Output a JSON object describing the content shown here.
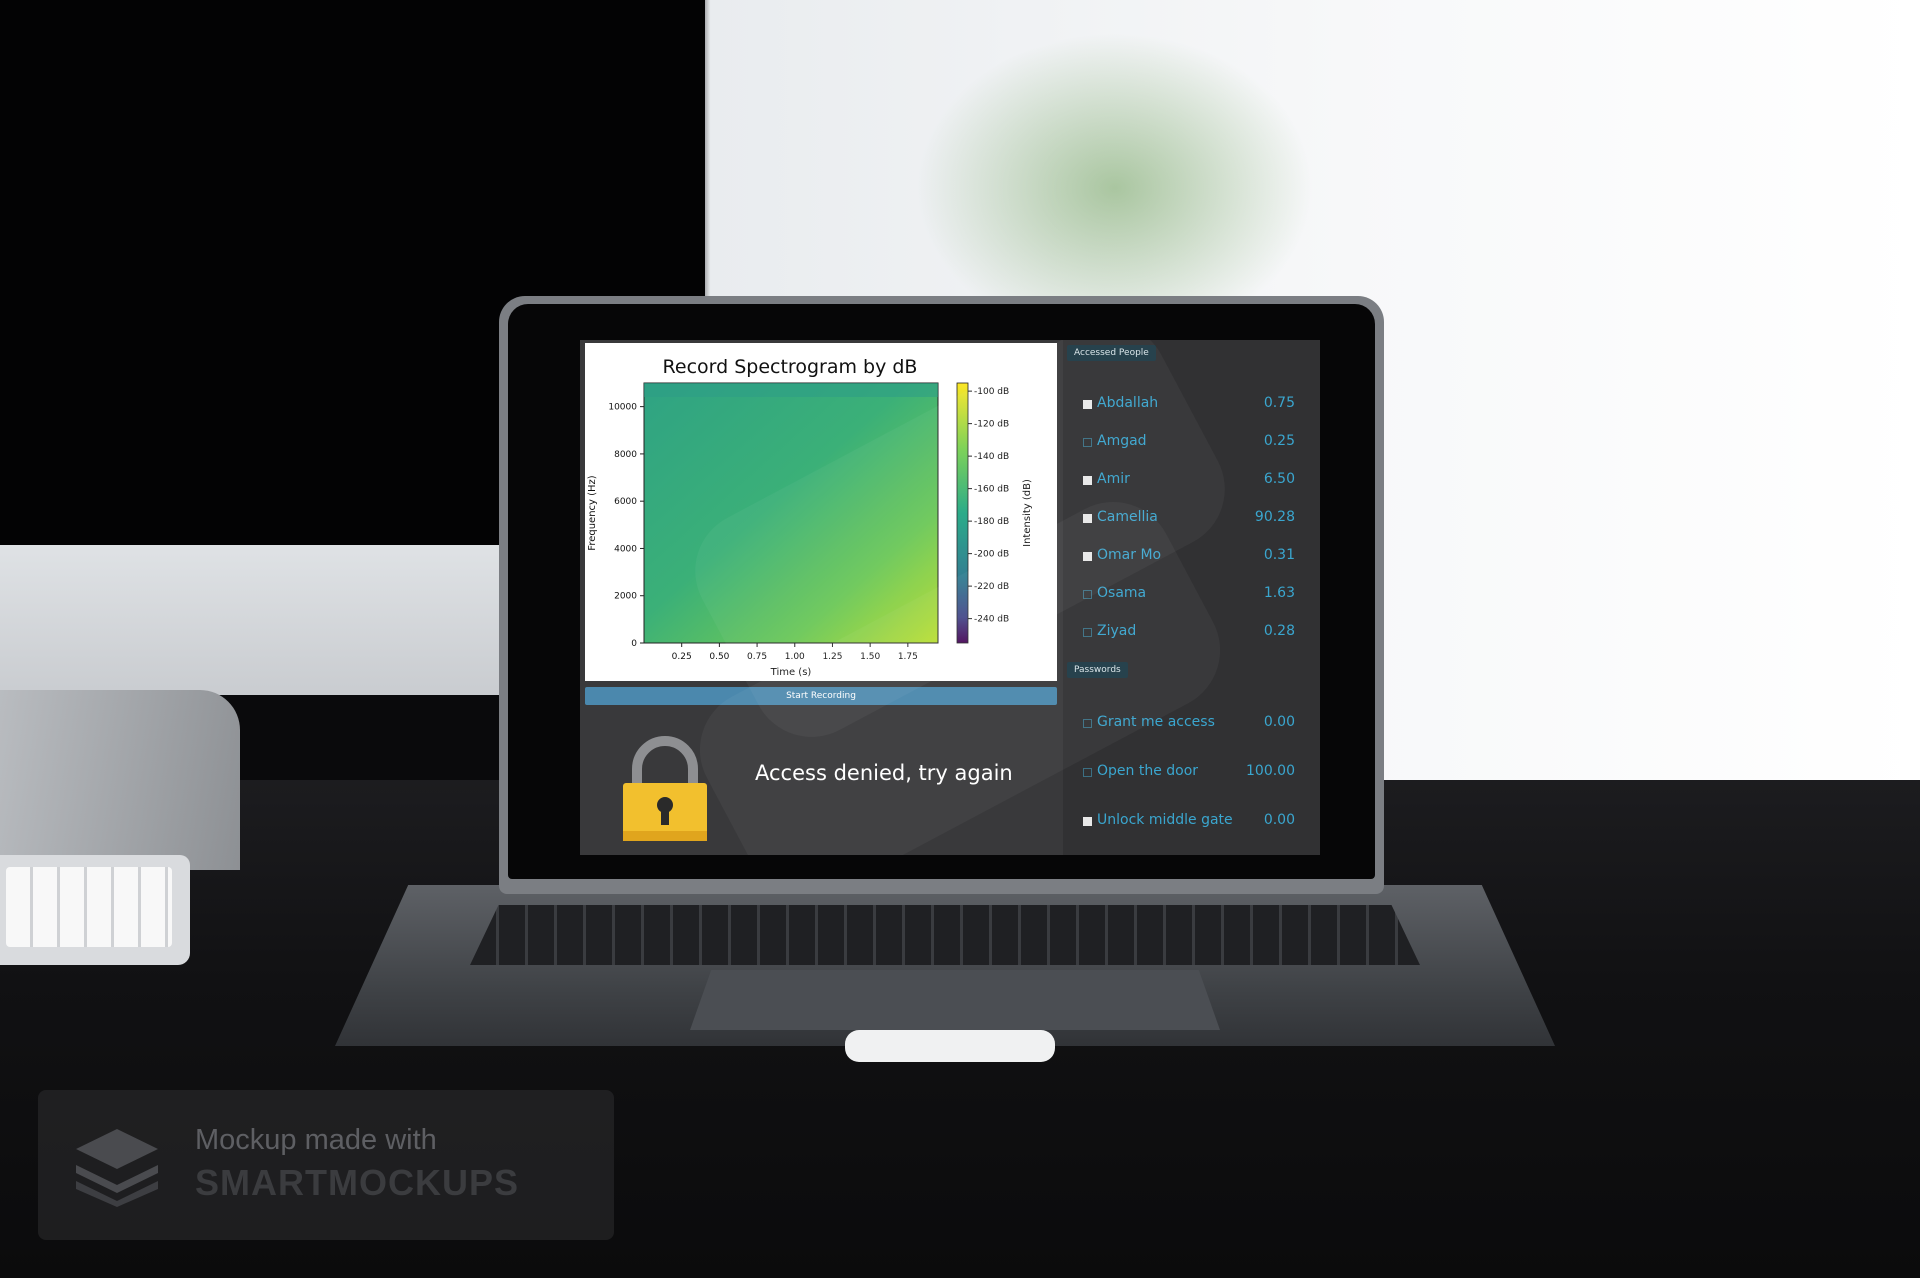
{
  "chart": {
    "title": "Record Spectrogram by dB",
    "xlabel": "Time (s)",
    "ylabel": "Frequency (Hz)",
    "colorbar_label": "Intensity (dB)",
    "x_ticks": [
      "0.25",
      "0.50",
      "0.75",
      "1.00",
      "1.25",
      "1.50",
      "1.75"
    ],
    "y_ticks": [
      "0",
      "2000",
      "4000",
      "6000",
      "8000",
      "10000"
    ],
    "colorbar_ticks": [
      "-100 dB",
      "-120 dB",
      "-140 dB",
      "-160 dB",
      "-180 dB",
      "-200 dB",
      "-220 dB",
      "-240 dB"
    ]
  },
  "chart_data": {
    "type": "heatmap",
    "title": "Record Spectrogram by dB",
    "xlabel": "Time (s)",
    "ylabel": "Frequency (Hz)",
    "colorbar_label": "Intensity (dB)",
    "xlim": [
      0,
      1.95
    ],
    "ylim": [
      0,
      11000
    ],
    "clim": [
      -255,
      -95
    ],
    "colormap": "viridis"
  },
  "record_button": {
    "label": "Start Recording"
  },
  "status": {
    "message": "Access denied, try again",
    "icon": "lock-icon"
  },
  "accessed_people": {
    "title": "Accessed People",
    "items": [
      {
        "name": "Abdallah",
        "value": "0.75",
        "checked": true
      },
      {
        "name": "Amgad",
        "value": "0.25",
        "checked": false
      },
      {
        "name": "Amir",
        "value": "6.50",
        "checked": true
      },
      {
        "name": "Camellia",
        "value": "90.28",
        "checked": true
      },
      {
        "name": "Omar Mo",
        "value": "0.31",
        "checked": true
      },
      {
        "name": "Osama",
        "value": "1.63",
        "checked": false
      },
      {
        "name": "Ziyad",
        "value": "0.28",
        "checked": false
      }
    ]
  },
  "passwords": {
    "title": "Passwords",
    "items": [
      {
        "name": "Grant me access",
        "value": "0.00",
        "checked": false
      },
      {
        "name": "Open the door",
        "value": "100.00",
        "checked": false
      },
      {
        "name": "Unlock middle gate",
        "value": "0.00",
        "checked": true
      }
    ]
  },
  "watermark": {
    "line1": "Mockup made with",
    "line2": "SMARTMOCKUPS"
  },
  "colors": {
    "accent": "#3aa6cf",
    "button": "#4b88ad",
    "lock_body": "#f2c02e"
  }
}
